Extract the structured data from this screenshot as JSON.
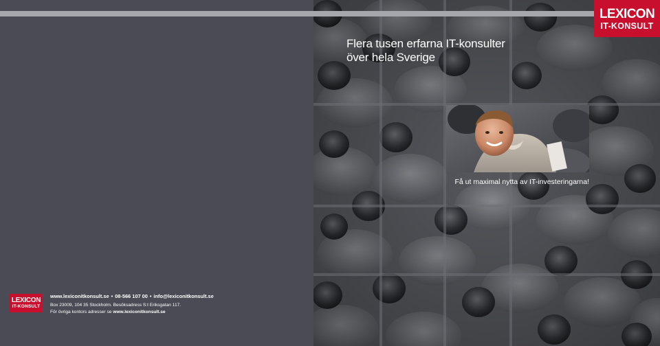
{
  "back_cover": {
    "logo": {
      "line1": "LEXICON",
      "line2": "IT-KONSULT"
    },
    "contact": {
      "website": "www.lexiconitkonsult.se",
      "phone": "08-566 107 00",
      "email": "info@lexiconitkonsult.se",
      "separator": "•"
    },
    "address": "Box 23009, 104 35 Stockholm. Besöksadress S:t Eriksgatan 117.",
    "other_offices_prefix": "För övriga kontors adresser se ",
    "other_offices_link": "www.lexiconitkonsult.se"
  },
  "front_cover": {
    "logo": {
      "line1": "LEXICON",
      "line2": "IT-KONSULT"
    },
    "headline_line1": "Flera tusen erfarna IT-konsulter",
    "headline_line2": "över hela Sverige",
    "tagline": "Få ut maximal nytta av IT-investeringarna!"
  },
  "colors": {
    "brand_red": "#c8102e",
    "panel_dark": "#4a4b55",
    "text": "#ffffff"
  }
}
